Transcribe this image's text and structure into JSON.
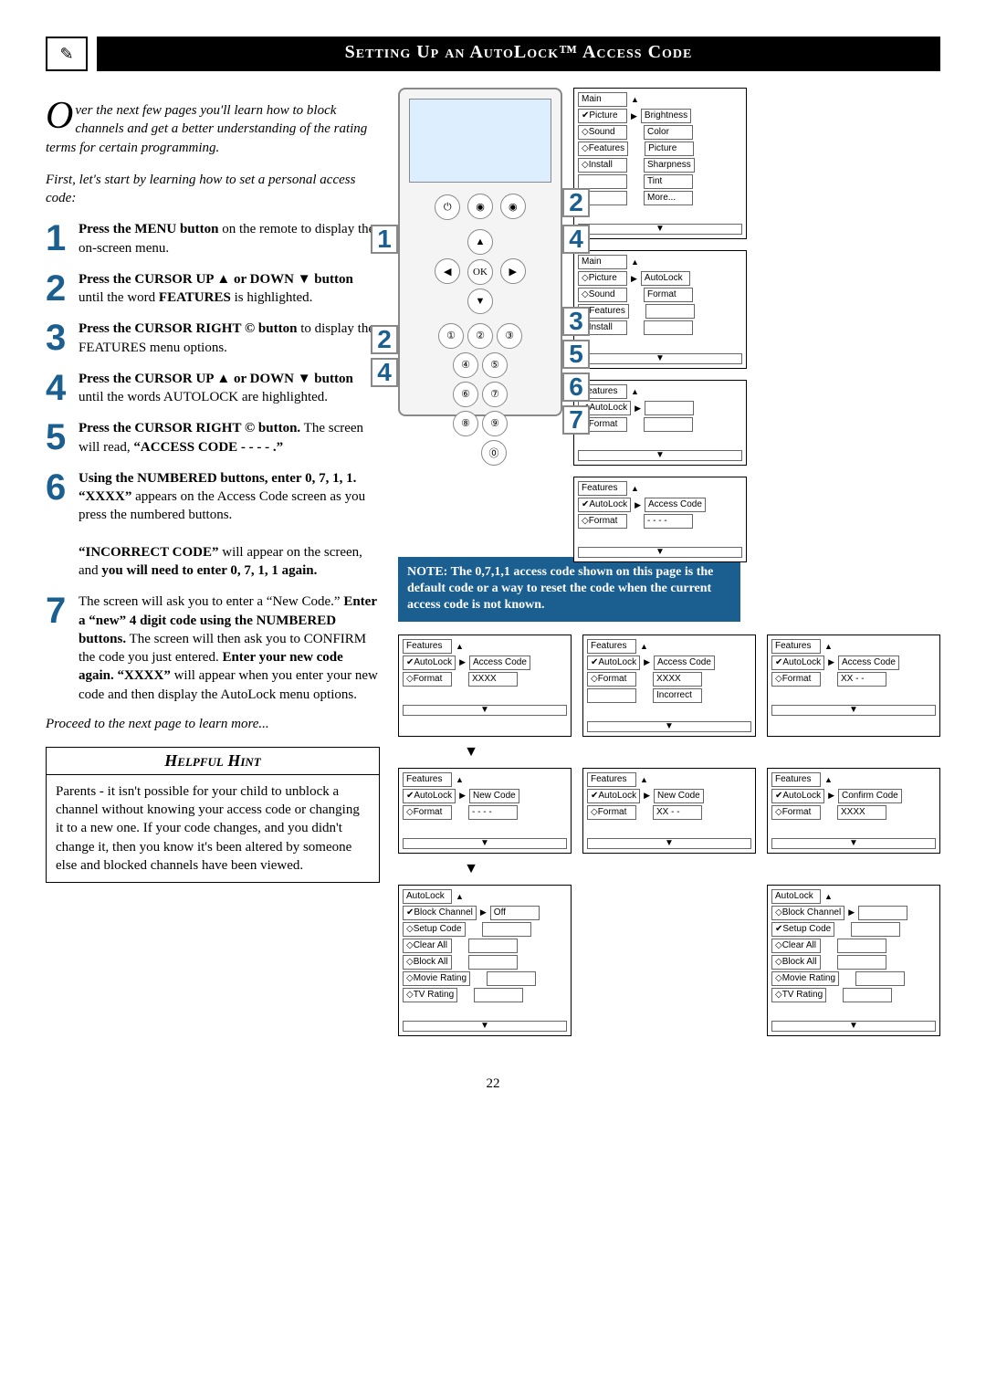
{
  "header": {
    "title": "Setting Up an AutoLock™ Access Code"
  },
  "intro": {
    "dropcap": "O",
    "p1_rest": "ver the next few pages you'll learn how to block channels and get a better understanding of the rating terms for certain programming.",
    "p2": "First, let's start by learning how to set a personal access code:"
  },
  "steps": [
    {
      "num": "1",
      "html": "<b>Press the MENU button</b> on the remote to display the on-screen menu."
    },
    {
      "num": "2",
      "html": "<b>Press the CURSOR UP ▲ or DOWN ▼ button</b> until the word <b>FEATURES</b> is highlighted."
    },
    {
      "num": "3",
      "html": "<b>Press the CURSOR RIGHT © button</b> to display the FEATURES menu options."
    },
    {
      "num": "4",
      "html": "<b>Press the CURSOR UP ▲ or DOWN ▼ button</b> until the words AUTOLOCK are highlighted."
    },
    {
      "num": "5",
      "html": "<b>Press the CURSOR RIGHT © button.</b> The screen will read, <b>“ACCESS CODE - - - - .”</b>"
    },
    {
      "num": "6",
      "html": "<b>Using the NUMBERED buttons, enter 0, 7, 1, 1. “XXXX”</b> appears on the Access Code screen as you press the numbered buttons.<br><br><b>“INCORRECT CODE”</b> will appear on the screen, and <b>you will need to enter 0, 7, 1, 1 again.</b>"
    },
    {
      "num": "7",
      "html": "The screen will ask you to enter a “New Code.” <b>Enter a “new” 4 digit code using the NUMBERED buttons.</b> The screen will then ask you to CONFIRM the code you just entered. <b>Enter your new code again. “XXXX”</b> will appear when you enter your new code and then display the AutoLock menu options."
    }
  ],
  "proceed": "Proceed to the next page to learn more...",
  "hint": {
    "title": "Helpful Hint",
    "body": "Parents - it isn't possible for your child to unblock a channel without knowing your access code or changing it to a new one. If your code changes, and you didn't change it, then you know it's been altered by someone else and blocked channels have been viewed."
  },
  "note": "NOTE: The 0,7,1,1 access code shown on this page is the default code or a way to reset the code when the current access code is not known.",
  "osd": {
    "main1": {
      "title": "Main",
      "left": [
        "✔Picture",
        "◇Sound",
        "◇Features",
        "◇Install"
      ],
      "right": [
        "Brightness",
        "Color",
        "Picture",
        "Sharpness",
        "Tint",
        "More..."
      ]
    },
    "main2": {
      "title": "Main",
      "left": [
        "◇Picture",
        "◇Sound",
        "✔Features",
        "◇Install"
      ],
      "right": [
        "AutoLock",
        "Format"
      ]
    },
    "features1": {
      "title": "Features",
      "left": [
        "✔AutoLock",
        "◇Format"
      ],
      "right": [
        ""
      ]
    },
    "features_access": {
      "title": "Features",
      "left": [
        "✔AutoLock",
        "◇Format"
      ],
      "right": [
        "Access Code",
        "- - - -"
      ]
    },
    "features_xxxx": {
      "title": "Features",
      "left": [
        "✔AutoLock",
        "◇Format"
      ],
      "right": [
        "Access Code",
        "XXXX"
      ]
    },
    "features_incorrect": {
      "title": "Features",
      "left": [
        "✔AutoLock",
        "◇Format"
      ],
      "right": [
        "Access Code",
        "XXXX",
        "Incorrect"
      ]
    },
    "features_xx": {
      "title": "Features",
      "left": [
        "✔AutoLock",
        "◇Format"
      ],
      "right": [
        "Access Code",
        "XX - -"
      ]
    },
    "features_new1": {
      "title": "Features",
      "left": [
        "✔AutoLock",
        "◇Format"
      ],
      "right": [
        "New Code",
        "- - - -"
      ]
    },
    "features_new2": {
      "title": "Features",
      "left": [
        "✔AutoLock",
        "◇Format"
      ],
      "right": [
        "New Code",
        "XX - -"
      ]
    },
    "features_confirm": {
      "title": "Features",
      "left": [
        "✔AutoLock",
        "◇Format"
      ],
      "right": [
        "Confirm Code",
        "XXXX"
      ]
    },
    "autolock1": {
      "title": "AutoLock",
      "left": [
        "✔Block Channel",
        "◇Setup Code",
        "◇Clear All",
        "◇Block All",
        "◇Movie Rating",
        "◇TV Rating"
      ],
      "right": [
        "Off"
      ]
    },
    "autolock2": {
      "title": "AutoLock",
      "left": [
        "◇Block Channel",
        "✔Setup Code",
        "◇Clear All",
        "◇Block All",
        "◇Movie Rating",
        "◇TV Rating"
      ],
      "right": [
        ""
      ]
    }
  },
  "remote": {
    "numpad": [
      "①",
      "②",
      "③",
      "④",
      "⑤",
      "⑥",
      "⑦",
      "⑧",
      "⑨",
      "",
      "⓪",
      ""
    ]
  },
  "callouts": [
    "1",
    "2",
    "3",
    "4",
    "5",
    "6",
    "7"
  ],
  "callouts_left": [
    "2",
    "4"
  ],
  "page": "22"
}
